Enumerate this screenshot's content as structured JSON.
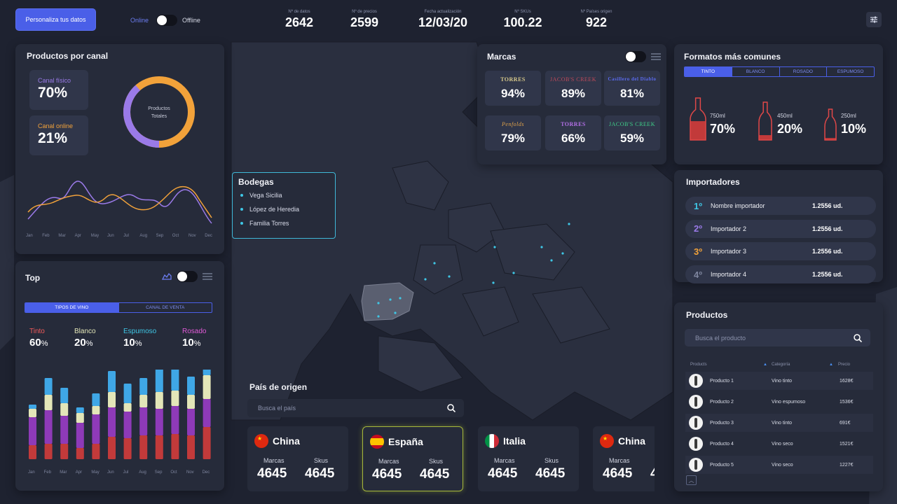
{
  "topbar": {
    "personalize_label": "Personaliza tus datos",
    "online_label": "Online",
    "offline_label": "Offline",
    "stats": [
      {
        "label": "Nº de datos",
        "value": "2642"
      },
      {
        "label": "Nº de precios",
        "value": "2599"
      },
      {
        "label": "Fecha actualización",
        "value": "12/03/20"
      },
      {
        "label": "Nº SKUs",
        "value": "100.22"
      },
      {
        "label": "Nº Países origen",
        "value": "922"
      }
    ]
  },
  "canal": {
    "title": "Productos por canal",
    "fisico_label": "Canal físico",
    "fisico_value": "70%",
    "fisico_fraction": 0.7,
    "online_label": "Canal online",
    "online_value": "21%",
    "donut_label_1": "Productos",
    "donut_label_2": "Totales",
    "months": [
      "Jan",
      "Feb",
      "Mar",
      "Apr",
      "May",
      "Jun",
      "Jul",
      "Aug",
      "Sep",
      "Oct",
      "Nov",
      "Dec"
    ]
  },
  "bodegas": {
    "title": "Bodegas",
    "items": [
      "Vega Sicilia",
      "López de Heredia",
      "Familia Torres"
    ]
  },
  "marcas": {
    "title": "Marcas",
    "brands": [
      {
        "logo": "TORRES",
        "value": "94%",
        "color": "#d8c98a"
      },
      {
        "logo": "JACOB'S CREEK",
        "value": "89%",
        "color": "#c24a5a"
      },
      {
        "logo": "Casillero del Diablo",
        "value": "81%",
        "color": "#5b6bf0"
      },
      {
        "logo": "Penfolds",
        "value": "79%",
        "color": "#e0a34a"
      },
      {
        "logo": "TORRES",
        "value": "66%",
        "color": "#b470e8"
      },
      {
        "logo": "JACOB'S CREEK",
        "value": "59%",
        "color": "#3fd28a"
      }
    ]
  },
  "formatos": {
    "title": "Formatos más comunes",
    "tabs": [
      "TINTO",
      "BLANCO",
      "ROSADO",
      "ESPUMOSO"
    ],
    "items": [
      {
        "size": "750ml",
        "value": "70%",
        "fill": 0.7
      },
      {
        "size": "450ml",
        "value": "20%",
        "fill": 0.2
      },
      {
        "size": "250ml",
        "value": "10%",
        "fill": 0.1
      }
    ]
  },
  "importadores": {
    "title": "Importadores",
    "rows": [
      {
        "rank": "1º",
        "name": "Nombre importador",
        "amount": "1.2556 ud.",
        "color": "#3fc7e6"
      },
      {
        "rank": "2º",
        "name": "Importador 2",
        "amount": "1.2556 ud.",
        "color": "#9a7ae8"
      },
      {
        "rank": "3º",
        "name": "Importador 3",
        "amount": "1.2556 ud.",
        "color": "#f2a23a"
      },
      {
        "rank": "4º",
        "name": "Importador 4",
        "amount": "1.2556 ud.",
        "color": "#7e859e"
      }
    ]
  },
  "productos": {
    "title": "Productos",
    "search_placeholder": "Busca el producto",
    "col_productos": "Products",
    "col_categoria": "Categoría",
    "col_precio": "Precio",
    "rows": [
      {
        "name": "Producto 1",
        "cat": "Vino tinto",
        "price": "1628€"
      },
      {
        "name": "Producto 2",
        "cat": "Vino espumoso",
        "price": "1536€"
      },
      {
        "name": "Producto 3",
        "cat": "Vino tinto",
        "price": "691€"
      },
      {
        "name": "Producto 4",
        "cat": "Vino seco",
        "price": "1521€"
      },
      {
        "name": "Producto 5",
        "cat": "Vino seco",
        "price": "1227€"
      }
    ]
  },
  "top": {
    "title": "Top",
    "tabs": [
      "TIPOS DE VINO",
      "CANAL DE VENTA"
    ],
    "cats": [
      {
        "label": "Tinto",
        "value": "60",
        "color": "#f25a5a"
      },
      {
        "label": "Blanco",
        "value": "20",
        "color": "#e3e6b8"
      },
      {
        "label": "Espumoso",
        "value": "10",
        "color": "#3fc7e6"
      },
      {
        "label": "Rosado",
        "value": "10",
        "color": "#e25ad8"
      }
    ],
    "pct_symbol": "%",
    "months": [
      "Jan",
      "Feb",
      "Mar",
      "Apr",
      "May",
      "Jun",
      "Jul",
      "Aug",
      "Sep",
      "Oct",
      "Nov",
      "Dec"
    ]
  },
  "pais": {
    "title": "País de origen",
    "search_placeholder": "Busca el país",
    "marcas_label": "Marcas",
    "skus_label": "Skus",
    "cards": [
      {
        "name": "China",
        "marcas": "4645",
        "skus": "4645"
      },
      {
        "name": "España",
        "marcas": "4645",
        "skus": "4645"
      },
      {
        "name": "Italia",
        "marcas": "4645",
        "skus": "4645"
      },
      {
        "name": "China",
        "marcas": "4645",
        "skus": "4"
      }
    ]
  },
  "colors": {
    "accent": "#4a5fe8",
    "orange": "#f2a23a",
    "purple": "#9a7ae8",
    "cyan": "#3fc7e6"
  }
}
